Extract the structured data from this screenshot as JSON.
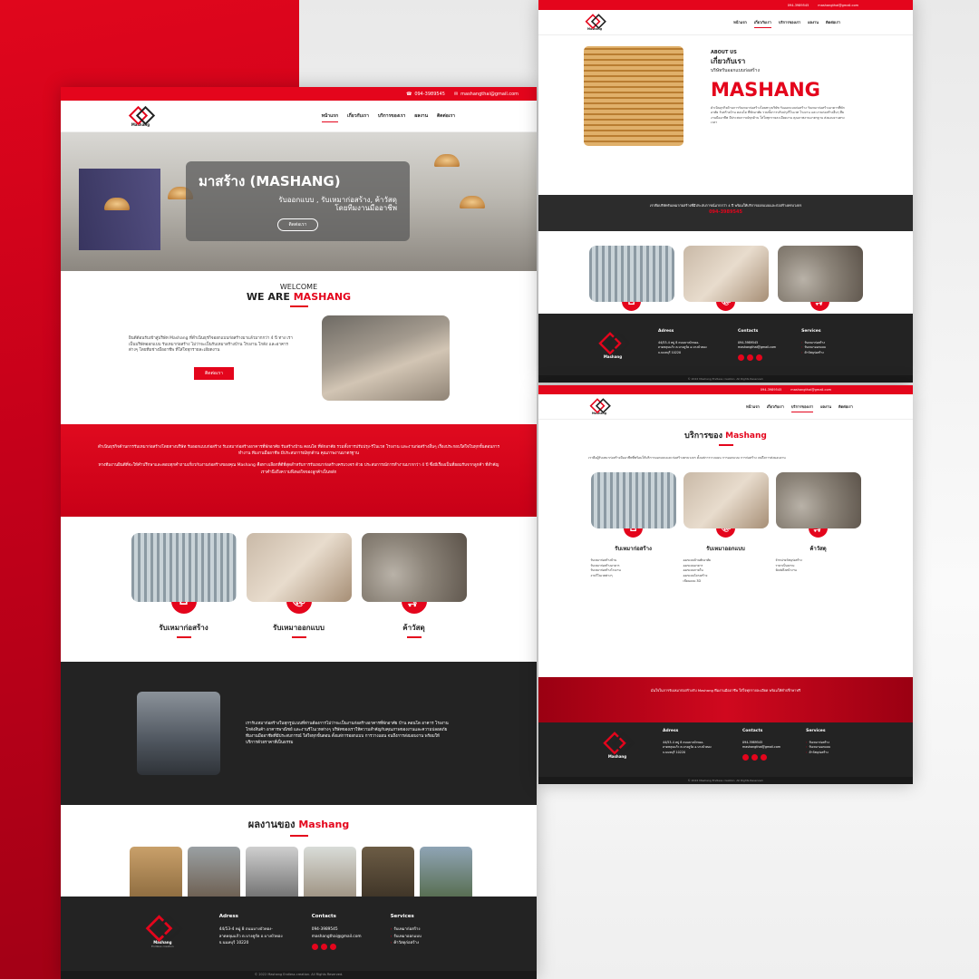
{
  "contact": {
    "phone": "094-3989545",
    "email": "mashangthai@gmail.com"
  },
  "brand": {
    "name": "Mashang",
    "tagline": "Endless creation"
  },
  "nav": {
    "items": [
      "หน้าแรก",
      "เกี่ยวกับเรา",
      "บริการของเรา",
      "ผลงาน",
      "ติดต่อเรา"
    ]
  },
  "hero": {
    "title": "มาสร้าง (MASHANG)",
    "subtitle": "รับออกแบบ , รับเหมาก่อสร้าง, ค้าวัสดุ",
    "subtitle2": "โดยทีมงานมืออาชีพ",
    "button": "ติดต่อเรา"
  },
  "welcome": {
    "line1": "WELCOME",
    "line2a": "WE ARE ",
    "line2b": "MASHANG",
    "text": "ยินดีต้อนรับเข้าสู่บริษัท Mashang ที่ดำเนินธุรกิจออกแบบก่อสร้างมาแล้วมากกว่า 4 ปี ทาง เราเป็นบริษัทออกแบบ รับเหมาก่อสร้าง ไม่ว่าจะเป็นรับเหมาสร้างบ้าน โรงงาน โกดัง และอาคารต่างๆ โดยทีมช่างมืออาชีพ ที่ใส่ใจทุกรายละเอียดงาน",
    "button": "ติดต่อเรา"
  },
  "red_band": {
    "p1": "ดำเนินธุรกิจด้านการรับเหมาก่อสร้างโดยทางบริษัท รับออกแบบก่อสร้าง รับเหมาก่อสร้างอาคารที่พักอาศัย รับสร้างบ้าน คอนโด ที่พักอาศัย รวมทั้งการปรับปรุง-รีโนเวท โรงงาน และงานก่อสร้างอื่นๆ เรื่องประกอบใส่ใจในทุกขั้นตอนการทำงาน ทีมงานมืออาชีพ มีประสบการณ์ทุกด้าน คุณภาพงานมาตรฐาน",
    "p2": "ทางทีมงานยินดีที่จะให้คำปรึกษาและตอบทุกคำถามเกี่ยวกับงานก่อสร้างของคุณ Mashang คือทางเลือกที่ดีที่สุดสำหรับการรับเหมาก่อสร้างครบวงจร ด้วย ประสบการณ์การทำงานมากกว่า 4 ปี ซึ่งมีเรื่องเป็นที่ยอมรับจากลูกค้า ที่สำคัญเราคำนึงถึงความพึงพอใจของลูกค้าเป็นหลัก"
  },
  "services": [
    {
      "label": "รับเหมาก่อสร้าง",
      "icon": "home-icon"
    },
    {
      "label": "รับเหมาออกแบบ",
      "icon": "palette-icon"
    },
    {
      "label": "ค้าวัสดุ",
      "icon": "cart-icon"
    }
  ],
  "dark_band": {
    "text": "เรารับเหมาก่อสร้างในทุกรูปแบบที่ท่านต้องการไม่ว่าจะเป็นงานก่อสร้างอาคารที่พักอาศัย บ้าน คอนโด อาคาร โรงงาน โกดังสินค้า อาคารพาณิชย์ และงานรีโนเวทต่างๆ บริษัทของเราให้ความสำคัญกับคุณภาพของงานและความปลอดภัย ทีมงานมืออาชีพที่มีประสบการณ์ ใส่ใจทุกขั้นตอน ตั้งแต่การออกแบบ การวางแผน จนถึงการส่งมอบงาน พร้อมให้บริการด้วยราคาที่เป็นธรรม"
  },
  "works": {
    "title_a": "ผลงานของ ",
    "title_b": "Mashang"
  },
  "footer": {
    "address_title": "Adress",
    "address": "44/53-4 หมู่ 8 ถนนบางบัวทอง-ลาดหลุมแก้ว ต.บางคูรัด อ.บางบัวทอง จ.นนทบุรี 10220",
    "contacts_title": "Contacts",
    "services_title": "Services",
    "services": [
      "รับเหมาก่อสร้าง",
      "รับเหมาออกแบบ",
      "ค้าวัสดุก่อสร้าง"
    ],
    "copyright": "© 2022 Mashang Endless creation. All Rights Reserved."
  },
  "about": {
    "label": "ABOUT US",
    "title": "เกี่ยวกับเรา",
    "subtitle": "บริษัทรับออกแบบก่อสร้าง",
    "brand": "MASHANG",
    "text": "ดำเนินธุรกิจด้านการรับเหมาก่อสร้างโดยทางบริษัท รับออกแบบก่อสร้าง รับเหมาก่อสร้างอาคารที่พักอาศัย รับสร้างบ้าน คอนโด ที่พักอาศัย รวมทั้งการปรับปรุงรีโนเวท โรงงาน และงานก่อสร้างอื่นๆ ทีมงานมืออาชีพ มีประสบการณ์ทุกด้าน ใส่ใจทุกรายละเอียดงาน คุณภาพงานมาตรฐาน ส่งมอบงานตรงเวลา",
    "band_text": "เราคือบริษัทรับเหมาก่อสร้างที่มีประสบการณ์มากกว่า 4 ปี พร้อมให้บริการออกแบบและก่อสร้างครบวงจร",
    "band_phone": "094-3989545"
  },
  "services_page": {
    "title_a": "บริการของ ",
    "title_b": "Mashang",
    "intro": "เราคือผู้รับเหมาก่อสร้างมืออาชีพที่พร้อมให้บริการออกแบบและก่อสร้างครบวงจร ตั้งแต่การวางแผน การออกแบบ การก่อสร้าง จนถึงการส่งมอบงาน",
    "cols": [
      {
        "label": "รับเหมาก่อสร้าง",
        "items": [
          "รับเหมาก่อสร้างบ้าน",
          "รับเหมาก่อสร้างอาคาร",
          "รับเหมาก่อสร้างโรงงาน",
          "งานรีโนเวทต่างๆ"
        ]
      },
      {
        "label": "รับเหมาออกแบบ",
        "items": [
          "ออกแบบบ้านพักอาศัย",
          "ออกแบบอาคาร",
          "ออกแบบภายใน",
          "ออกแบบโครงสร้าง",
          "เขียนแบบ 3D"
        ]
      },
      {
        "label": "ค้าวัสดุ",
        "items": [
          "จำหน่ายวัสดุก่อสร้าง",
          "ราคาเป็นธรรม",
          "จัดส่งถึงหน้างาน"
        ]
      }
    ],
    "band": "มั่นใจในการรับเหมาก่อสร้างกับ Mashang ทีมงานมืออาชีพ ใส่ใจทุกรายละเอียด พร้อมให้คำปรึกษาฟรี"
  }
}
